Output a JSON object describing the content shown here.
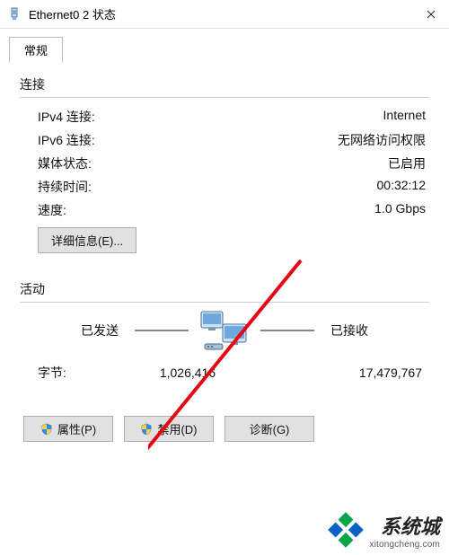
{
  "window": {
    "title": "Ethernet0 2 状态"
  },
  "tabs": {
    "general": "常规"
  },
  "connection": {
    "section": "连接",
    "ipv4_label": "IPv4 连接:",
    "ipv4_value": "Internet",
    "ipv6_label": "IPv6 连接:",
    "ipv6_value": "无网络访问权限",
    "media_label": "媒体状态:",
    "media_value": "已启用",
    "duration_label": "持续时间:",
    "duration_value": "00:32:12",
    "speed_label": "速度:",
    "speed_value": "1.0 Gbps",
    "details_button": "详细信息(E)..."
  },
  "activity": {
    "section": "活动",
    "sent_label": "已发送",
    "received_label": "已接收",
    "bytes_label": "字节:",
    "bytes_sent": "1,026,416",
    "bytes_received": "17,479,767"
  },
  "buttons": {
    "properties": "属性(P)",
    "disable": "禁用(D)",
    "diagnose": "诊断(G)"
  },
  "watermark": {
    "cn": "系统城",
    "en": "xitongcheng.com"
  }
}
